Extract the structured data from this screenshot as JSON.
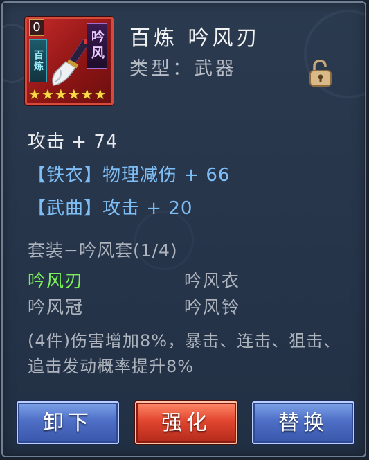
{
  "item": {
    "level": "0",
    "tag_left": "百炼",
    "tag_right": "吟风",
    "stars": 6,
    "name": "百炼 吟风刃",
    "type": "类型：武器"
  },
  "stats": {
    "attack": "攻击 + 74",
    "bonus1": "【铁衣】物理减伤 + 66",
    "bonus2": "【武曲】攻击 + 20"
  },
  "set": {
    "title": "套装−吟风套(1/4)",
    "pieces": [
      "吟风刃",
      "吟风衣",
      "吟风冠",
      "吟风铃"
    ],
    "effect": "(4件)伤害增加8%，暴击、连击、狙击、追击发动概率提升8%"
  },
  "buttons": {
    "unequip": "卸下",
    "enhance": "强化",
    "replace": "替换"
  },
  "colors": {
    "equipped_piece": "#7cf05a",
    "bonus_text": "#7fbef5",
    "accent_red": "#e2462f",
    "accent_blue": "#4e6fc6"
  },
  "icons": {
    "lock": "unlocked-padlock-icon",
    "star": "star-icon"
  }
}
